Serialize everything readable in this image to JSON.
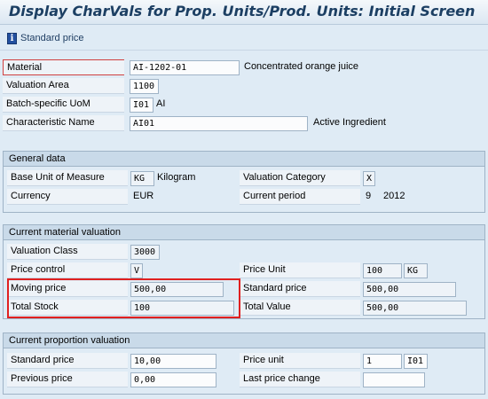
{
  "window": {
    "title": "Display CharVals for Prop. Units/Prod. Units: Initial Screen"
  },
  "toolbar": {
    "standard_price_label": "Standard price",
    "icon": "info-icon"
  },
  "header": {
    "material_label": "Material",
    "material_value": "AI-1202-01",
    "material_desc": "Concentrated orange juice",
    "valuation_area_label": "Valuation Area",
    "valuation_area_value": "1100",
    "batch_uom_label": "Batch-specific UoM",
    "batch_uom_value": "I01",
    "batch_uom_desc": "AI",
    "char_name_label": "Characteristic Name",
    "char_name_value": "AI01",
    "char_name_desc": "Active Ingredient"
  },
  "general": {
    "title": "General data",
    "base_uom_label": "Base Unit of Measure",
    "base_uom_value": "KG",
    "base_uom_desc": "Kilogram",
    "val_cat_label": "Valuation Category",
    "val_cat_value": "X",
    "currency_label": "Currency",
    "currency_value": "EUR",
    "period_label": "Current period",
    "period_month": "9",
    "period_year": "2012"
  },
  "valuation": {
    "title": "Current material valuation",
    "val_class_label": "Valuation Class",
    "val_class_value": "3000",
    "price_control_label": "Price control",
    "price_control_value": "V",
    "price_unit_label": "Price Unit",
    "price_unit_value": "100",
    "price_unit_uom": "KG",
    "moving_price_label": "Moving price",
    "moving_price_value": "500,00",
    "standard_price_label": "Standard price",
    "standard_price_value": "500,00",
    "total_stock_label": "Total Stock",
    "total_stock_value": "100",
    "total_value_label": "Total Value",
    "total_value_value": "500,00"
  },
  "proportion": {
    "title": "Current proportion valuation",
    "standard_price_label": "Standard price",
    "standard_price_value": "10,00",
    "price_unit_label": "Price unit",
    "price_unit_value": "1",
    "price_unit_uom": "I01",
    "previous_price_label": "Previous price",
    "previous_price_value": "0,00",
    "last_change_label": "Last price change",
    "last_change_value": ""
  }
}
